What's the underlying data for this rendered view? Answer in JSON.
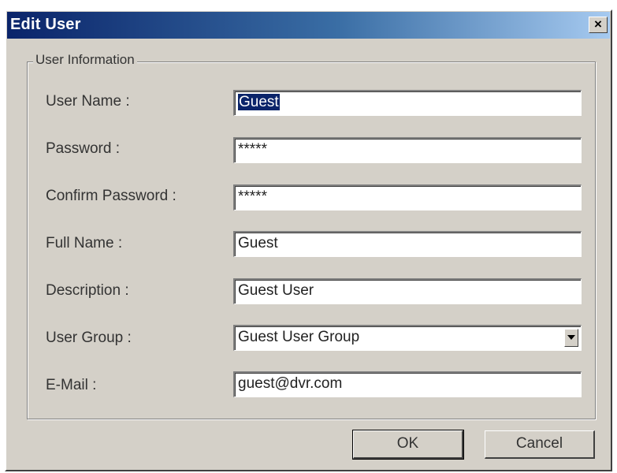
{
  "window": {
    "title": "Edit User",
    "close_glyph": "×"
  },
  "group": {
    "legend": "User Information"
  },
  "fields": [
    {
      "label": "User Name :",
      "value": "Guest"
    },
    {
      "label": "Password :",
      "value": "*****"
    },
    {
      "label": "Confirm Password :",
      "value": "*****"
    },
    {
      "label": "Full Name :",
      "value": "Guest"
    },
    {
      "label": "Description :",
      "value": "Guest User"
    },
    {
      "label": "User Group :",
      "value": "Guest User Group"
    },
    {
      "label": "E-Mail :",
      "value": "guest@dvr.com"
    }
  ],
  "buttons": {
    "ok": "OK",
    "cancel": "Cancel"
  },
  "icons": {
    "close": "close-icon",
    "dropdown": "chevron-down-icon"
  },
  "colors": {
    "title_bar_start": "#0a246a",
    "title_bar_end": "#a6caf0",
    "dialog_bg": "#d4d0c8",
    "selection": "#0a246a"
  }
}
